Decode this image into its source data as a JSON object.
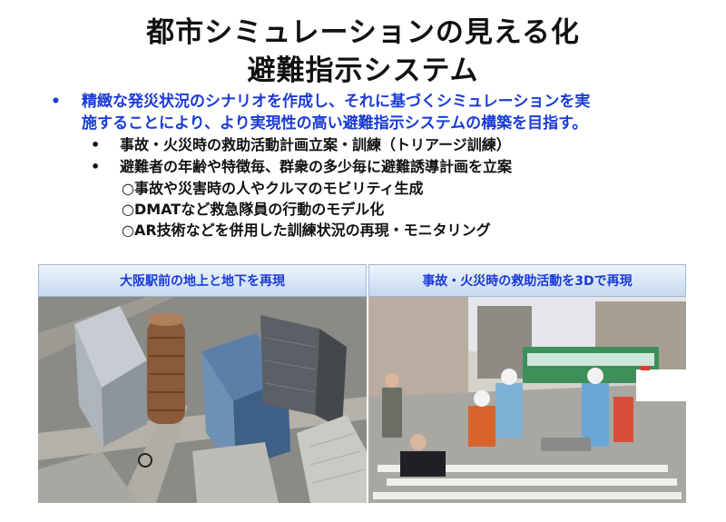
{
  "slide": {
    "title_line1": "都市シミュレーションの見える化",
    "title_line2": "避難指示システム",
    "main_bullet": {
      "line1": "精緻な発災状況のシナリオを作成し、それに基づくシミュレーションを実",
      "line2": "施することにより、より実現性の高い避難指示システムの構築を目指す。"
    },
    "sub_bullets": [
      "事故・火災時の救助活動計画立案・訓練（トリアージ訓練）",
      "避難者の年齢や特徴毎、群衆の多少毎に避難誘導計画を立案"
    ],
    "circle_items": [
      "○事故や災害時の人やクルマのモビリティ生成",
      "○DMATなど救急隊員の行動のモデル化",
      "○AR技術などを併用した訓練状況の再現・モニタリング"
    ],
    "panels": [
      {
        "caption": "大阪駅前の地上と地下を再現"
      },
      {
        "caption": "事故・火災時の救助活動を3Dで再現"
      }
    ]
  }
}
